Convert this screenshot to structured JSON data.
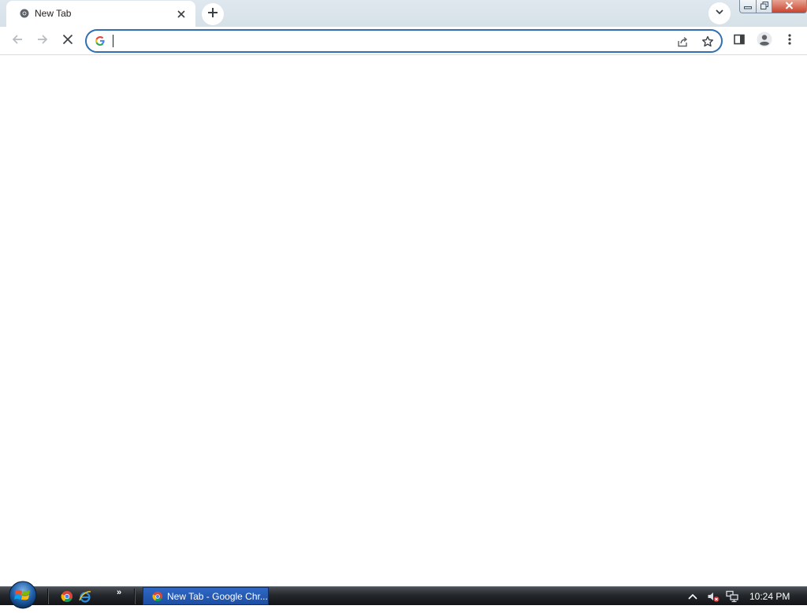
{
  "browser": {
    "tab": {
      "title": "New Tab",
      "favicon": "chrome-favicon-icon",
      "close_icon": "close-icon"
    },
    "new_tab_icon": "plus-icon",
    "tab_search_icon": "chevron-down-icon",
    "window_controls": [
      "minimize-icon",
      "restore-icon",
      "close-icon"
    ],
    "toolbar": {
      "back_icon": "arrow-left-icon",
      "forward_icon": "arrow-right-icon",
      "stop_icon": "close-icon",
      "omnibox": {
        "value": "",
        "placeholder": "",
        "search_engine_icon": "google-g-icon",
        "share_icon": "share-icon",
        "bookmark_icon": "star-icon"
      },
      "side_panel_icon": "side-panel-icon",
      "profile_icon": "avatar-icon",
      "menu_icon": "kebab-menu-icon"
    },
    "colors": {
      "accent": "#2f6fb2",
      "tab_strip": "#dfe8ee",
      "page": "#ffffff"
    }
  },
  "taskbar": {
    "start_icon": "windows-orb-icon",
    "quick_launch": [
      "chrome-icon",
      "internet-explorer-icon"
    ],
    "quick_launch_more": "»",
    "active_task": {
      "label": "New Tab - Google Chr...",
      "icon": "chrome-icon"
    },
    "tray": {
      "show_hidden_icon": "chevron-up-icon",
      "volume_icon": "volume-muted-icon",
      "network_icon": "network-icon",
      "clock": "10:24 PM"
    },
    "colors": {
      "active_task": "#2a5fb8"
    }
  }
}
